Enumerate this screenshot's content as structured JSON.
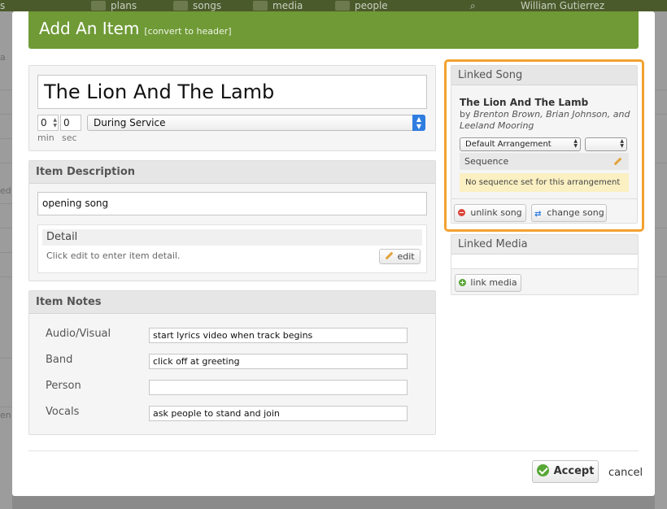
{
  "background": {
    "nav_items": [
      {
        "label": "plans",
        "icon": "plans-icon"
      },
      {
        "label": "songs",
        "icon": "music-note-icon"
      },
      {
        "label": "media",
        "icon": "film-icon"
      },
      {
        "label": "people",
        "icon": "people-icon"
      }
    ],
    "user_name": "William Gutierrez",
    "left_fragment_1": "a",
    "left_fragment_2": "ed",
    "left_fragment_3": "en",
    "logo_fragment": "s"
  },
  "modal": {
    "title": "Add An Item",
    "title_note": "[convert to header]"
  },
  "item": {
    "title": "The Lion And The Lamb",
    "min_value": "0",
    "sec_value": "0",
    "min_label": "min",
    "sec_label": "sec",
    "timing": "During Service"
  },
  "description": {
    "heading": "Item Description",
    "value": "opening song",
    "detail_heading": "Detail",
    "detail_text": "Click edit to enter item detail.",
    "edit_label": "edit"
  },
  "notes": {
    "heading": "Item Notes",
    "rows": [
      {
        "label": "Audio/Visual",
        "value": "start lyrics video when track begins"
      },
      {
        "label": "Band",
        "value": "click off at greeting"
      },
      {
        "label": "Person",
        "value": ""
      },
      {
        "label": "Vocals",
        "value": "ask people to stand and join"
      }
    ]
  },
  "linked_song": {
    "heading": "Linked Song",
    "title": "The Lion And The Lamb",
    "by_prefix": "by",
    "authors": "Brenton Brown, Brian Johnson, and Leeland Mooring",
    "arrangement": "Default Arrangement",
    "key": "",
    "sequence_label": "Sequence",
    "sequence_note": "No sequence set for this arrangement",
    "unlink_label": "unlink song",
    "change_label": "change song"
  },
  "linked_media": {
    "heading": "Linked Media",
    "link_label": "link media"
  },
  "footer": {
    "accept_label": "Accept",
    "cancel_label": "cancel"
  },
  "colors": {
    "header_green": "#6f9a36",
    "highlight_orange": "#f2a230",
    "accept_green": "#58a636",
    "sequence_note_bg": "#fbf0c2"
  }
}
